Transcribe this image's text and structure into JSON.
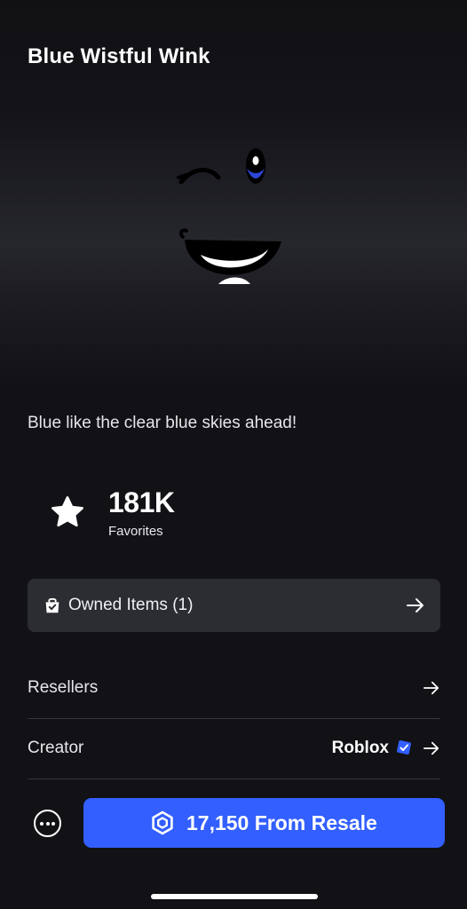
{
  "item": {
    "title": "Blue Wistful Wink",
    "description": "Blue like the clear blue skies ahead!",
    "image_icon": "face-wink-smile"
  },
  "favorites": {
    "count": "181K",
    "label": "Favorites",
    "icon": "star-icon"
  },
  "owned_items": {
    "label": "Owned Items (1)",
    "icon": "shopping-bag-check-icon",
    "arrow_icon": "arrow-right-icon"
  },
  "rows": {
    "resellers_label": "Resellers",
    "creator_label": "Creator",
    "creator_name": "Roblox",
    "verified_icon": "verified-badge-icon"
  },
  "purchase": {
    "more_icon": "more-options-icon",
    "currency_icon": "robux-icon",
    "button_label": "17,150 From Resale"
  },
  "colors": {
    "background": "#121216",
    "card": "#2b2d33",
    "accent": "#335fff",
    "verified": "#335fff",
    "eye_iris": "#2c46d8"
  }
}
